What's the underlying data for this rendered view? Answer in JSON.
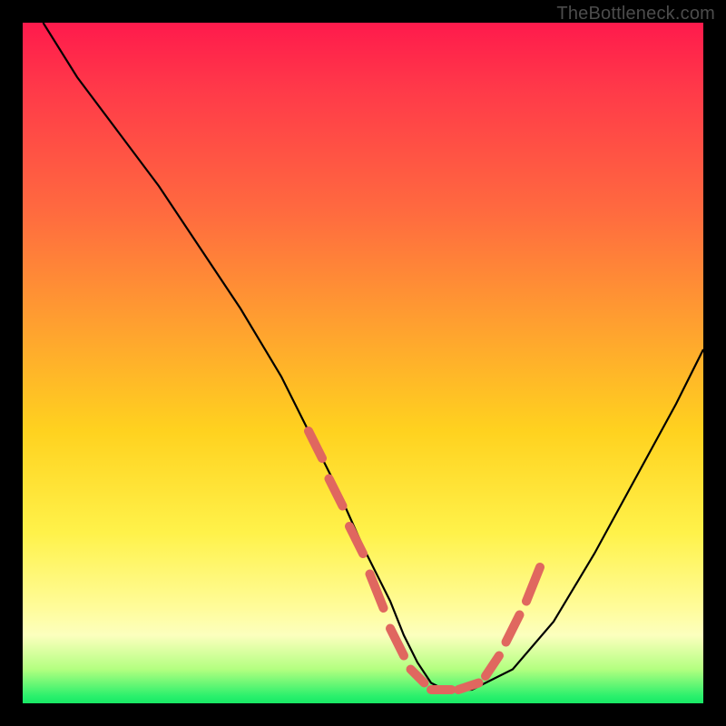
{
  "watermark": "TheBottleneck.com",
  "chart_data": {
    "type": "line",
    "title": "",
    "xlabel": "",
    "ylabel": "",
    "xlim": [
      0,
      100
    ],
    "ylim": [
      0,
      100
    ],
    "series": [
      {
        "name": "bottleneck-curve",
        "x": [
          3,
          8,
          14,
          20,
          26,
          32,
          38,
          42,
          46,
          50,
          54,
          56,
          58,
          60,
          62,
          66,
          72,
          78,
          84,
          90,
          96,
          100
        ],
        "y": [
          100,
          92,
          84,
          76,
          67,
          58,
          48,
          40,
          32,
          23,
          15,
          10,
          6,
          3,
          2,
          2,
          5,
          12,
          22,
          33,
          44,
          52
        ]
      }
    ],
    "markers": {
      "name": "highlight-dashes",
      "segments": [
        {
          "x1": 42,
          "y1": 40,
          "x2": 44,
          "y2": 36
        },
        {
          "x1": 45,
          "y1": 33,
          "x2": 47,
          "y2": 29
        },
        {
          "x1": 48,
          "y1": 26,
          "x2": 50,
          "y2": 22
        },
        {
          "x1": 51,
          "y1": 19,
          "x2": 53,
          "y2": 14
        },
        {
          "x1": 54,
          "y1": 11,
          "x2": 56,
          "y2": 7
        },
        {
          "x1": 57,
          "y1": 5,
          "x2": 59,
          "y2": 3
        },
        {
          "x1": 60,
          "y1": 2,
          "x2": 63,
          "y2": 2
        },
        {
          "x1": 64,
          "y1": 2,
          "x2": 67,
          "y2": 3
        },
        {
          "x1": 68,
          "y1": 4,
          "x2": 70,
          "y2": 7
        },
        {
          "x1": 71,
          "y1": 9,
          "x2": 73,
          "y2": 13
        },
        {
          "x1": 74,
          "y1": 15,
          "x2": 76,
          "y2": 20
        }
      ]
    },
    "background_gradient": {
      "stops": [
        {
          "pos": 0.0,
          "color": "#ff1a4c"
        },
        {
          "pos": 0.28,
          "color": "#ff6b3f"
        },
        {
          "pos": 0.6,
          "color": "#ffd21f"
        },
        {
          "pos": 0.9,
          "color": "#fcffbe"
        },
        {
          "pos": 1.0,
          "color": "#18e865"
        }
      ]
    }
  }
}
